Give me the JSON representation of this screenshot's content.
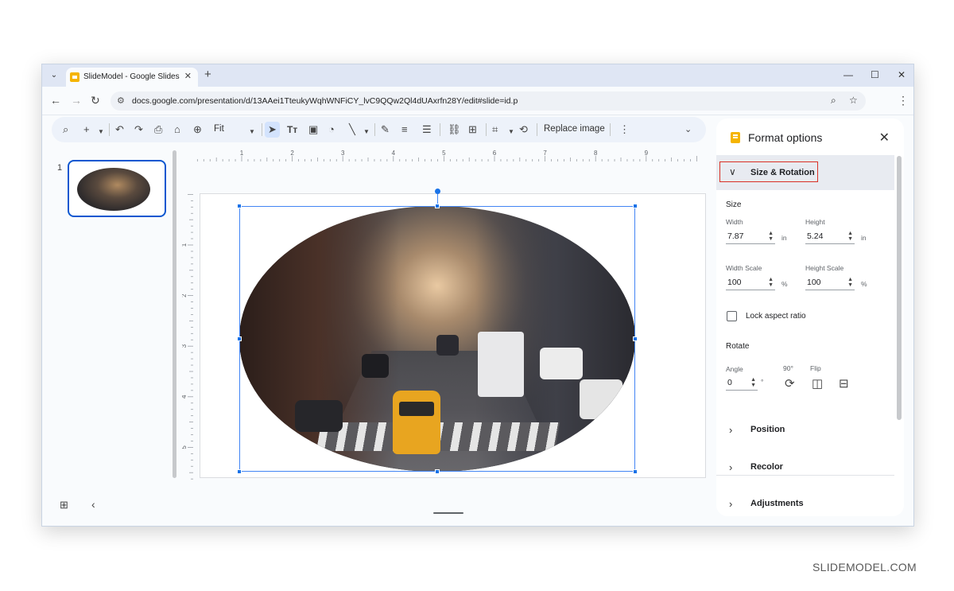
{
  "browser": {
    "tab_title": "SlideModel - Google Slides",
    "url": "docs.google.com/presentation/d/13AAei1TteukyWqhWNFiCY_lvC9QQw2Ql4dUAxrfn28Y/edit#slide=id.p"
  },
  "toolbar": {
    "zoom": "Fit",
    "replace_image": "Replace image"
  },
  "filmstrip": {
    "slide_number": "1"
  },
  "rulers": {
    "horizontal": [
      "1",
      "2",
      "3",
      "4",
      "5",
      "6",
      "7",
      "8",
      "9"
    ],
    "vertical": [
      "1",
      "2",
      "3",
      "4",
      "5"
    ]
  },
  "format_panel": {
    "title": "Format options",
    "sections": {
      "size_rotation": "Size & Rotation",
      "position": "Position",
      "recolor": "Recolor",
      "adjustments": "Adjustments"
    },
    "size": {
      "heading": "Size",
      "width_label": "Width",
      "width_value": "7.87",
      "height_label": "Height",
      "height_value": "5.24",
      "unit_in": "in",
      "width_scale_label": "Width Scale",
      "width_scale_value": "100",
      "height_scale_label": "Height Scale",
      "height_scale_value": "100",
      "unit_pct": "%",
      "lock_label": "Lock aspect ratio",
      "lock_checked": false
    },
    "rotate": {
      "heading": "Rotate",
      "angle_label": "Angle",
      "angle_value": "0",
      "angle_unit": "°",
      "rotate90_label": "90°",
      "flip_label": "Flip"
    }
  },
  "watermark": "SLIDEMODEL.COM",
  "colors": {
    "accent": "#1a73e8",
    "highlight_border": "#d93025",
    "slides_yellow": "#f5b400"
  }
}
